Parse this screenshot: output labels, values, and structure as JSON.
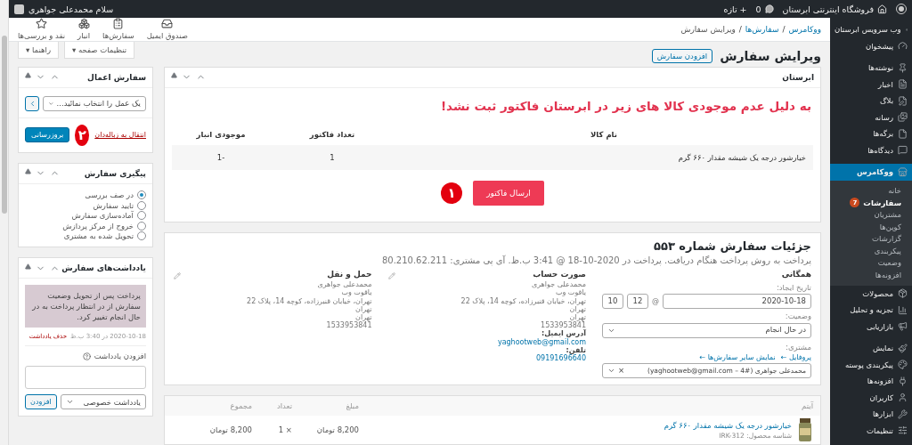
{
  "admin_bar": {
    "site_name": "فروشگاه اینترنتی ابرستان",
    "comments": "0",
    "new": "+ تازه",
    "greeting": "سلام محمدعلی جواهری"
  },
  "sidebar": {
    "groups": [
      [
        {
          "label": "وب سرویس ابرستان",
          "selected": false
        },
        {
          "label": "پیشخوان",
          "selected": false
        }
      ],
      [
        {
          "label": "نوشته‌ها",
          "selected": false
        },
        {
          "label": "اخبار",
          "selected": false
        },
        {
          "label": "بلاگ",
          "selected": false
        },
        {
          "label": "رسانه",
          "selected": false
        },
        {
          "label": "برگه‌ها",
          "selected": false
        },
        {
          "label": "دیدگاه‌ها",
          "selected": false
        }
      ],
      [
        {
          "label": "ووکامرس",
          "selected": true,
          "children": [
            {
              "label": "خانه",
              "selected": false
            },
            {
              "label": "سفارشات",
              "selected": true,
              "badge": "7"
            },
            {
              "label": "مشتریان",
              "selected": false
            },
            {
              "label": "کوپن‌ها",
              "selected": false
            },
            {
              "label": "گزارشات",
              "selected": false
            },
            {
              "label": "پیکربندی",
              "selected": false
            },
            {
              "label": "وضعیت",
              "selected": false
            },
            {
              "label": "افزونه‌ها",
              "selected": false
            }
          ]
        },
        {
          "label": "محصولات",
          "selected": false
        },
        {
          "label": "تجزیه و تحلیل",
          "selected": false
        },
        {
          "label": "بازاریابی",
          "selected": false
        }
      ],
      [
        {
          "label": "نمایش",
          "selected": false
        },
        {
          "label": "پیکربندی پوسته",
          "selected": false
        },
        {
          "label": "افزونه‌ها",
          "selected": false
        },
        {
          "label": "کاربران",
          "selected": false
        },
        {
          "label": "ابزارها",
          "selected": false
        },
        {
          "label": "تنظیمات",
          "selected": false
        }
      ]
    ]
  },
  "header": {
    "breadcrumb": [
      "ووکامرس",
      "سفارش‌ها",
      "ویرایش سفارش"
    ],
    "separator": "/",
    "tools": [
      "صندوق ایمیل",
      "سفارش‌ها",
      "انبار",
      "نقد و بررسی‌ها"
    ]
  },
  "page_title": "ویرایش سفارش",
  "add_button": "افزودن سفارش",
  "screen_options": [
    "تنظیمات صفحه ▾",
    "راهنما ▾"
  ],
  "abrestan_box": {
    "title": "ابرستان",
    "message": "به دلیل عدم موجودی کالا های زیر در ابرستان فاکتور ثبت نشد!",
    "columns": [
      "نام کالا",
      "تعداد فاکتور",
      "موجودی انبار"
    ],
    "rows": [
      [
        "خیارشور درجه یک شیشه مقدار ۶۶۰ گرم",
        "1",
        "-1"
      ]
    ],
    "button": "ارسال فاکتور",
    "step": "۱"
  },
  "order_details": {
    "title": "جزئیات سفارش شماره ۵۵۳",
    "subtitle": "پرداخت به روش پرداخت هنگام دریافت. پرداخت در 2020-10-18 @ 3:41 ب.ظ. آی پی مشتری: 80.210.62.211",
    "general": {
      "heading": "همگانی",
      "date_label": "تاریخ ایجاد:",
      "date": "2020-10-18",
      "at": "@",
      "hour": "12",
      "minute": "10",
      "status_label": "وضعیت:",
      "status": "در حال انجام",
      "customer_label": "مشتری:",
      "links": [
        "پروفایل ←",
        "نمایش سایر سفارش‌ها ←"
      ],
      "customer": "محمدعلی جواهری (#4 – yaghootweb@gmail.com)",
      "clear": "×"
    },
    "billing": {
      "heading": "صورت حساب",
      "lines": [
        "محمدعلی جواهری",
        "یاقوت وب",
        "تهران، خیابان قنبرزاده، کوچه 14، پلاک 22",
        "تهران",
        "تهران",
        "1533953841"
      ],
      "email_label": "آدرس ایمیل:",
      "email": "yaghootweb@gmail.com",
      "phone_label": "تلفن:",
      "phone": "09191696640"
    },
    "shipping": {
      "heading": "حمل و نقل",
      "lines": [
        "محمدعلی جواهری",
        "یاقوت وب",
        "تهران، خیابان قنبرزاده، کوچه 14، پلاک 22",
        "تهران",
        "تهران",
        "1533953841"
      ]
    }
  },
  "items_box": {
    "columns": [
      "آیتم",
      "مبلغ",
      "تعداد",
      "مجموع"
    ],
    "rows": [
      {
        "name": "خیارشور درجه یک شیشه مقدار ۶۶۰ گرم",
        "sku": "شناسه محصول: IRK-312",
        "cost": "8,200 تومان",
        "qty": "× 1",
        "total": "8,200 تومان"
      }
    ]
  },
  "order_actions": {
    "title": "سفارش اعمال",
    "select": "یک عمل را انتخاب نمائید...",
    "trash": "انتقال به زباله‌دان",
    "button": "بروزرسانی",
    "step": "۲"
  },
  "tracking": {
    "title": "پیگیری سفارش",
    "options": [
      {
        "label": "در صف بررسی",
        "selected": true
      },
      {
        "label": "تایید سفارش",
        "selected": false
      },
      {
        "label": "آماده‌سازی سفارش",
        "selected": false
      },
      {
        "label": "خروج از مرکز پردازش",
        "selected": false
      },
      {
        "label": "تحویل شده به مشتری",
        "selected": false
      }
    ]
  },
  "notes": {
    "title": "یادداشت‌های سفارش",
    "items": [
      {
        "text": "پرداخت پس از تحویل وضعیت سفارش از در انتظار پرداخت به در حال انجام تغییر کرد.",
        "date": "2020-10-18 در 3:40 ب.ظ",
        "delete": "حذف یادداشت"
      }
    ],
    "add_label": "افزودن یادداشت",
    "type": "یادداشت خصوصی",
    "add_button": "افزودن"
  }
}
